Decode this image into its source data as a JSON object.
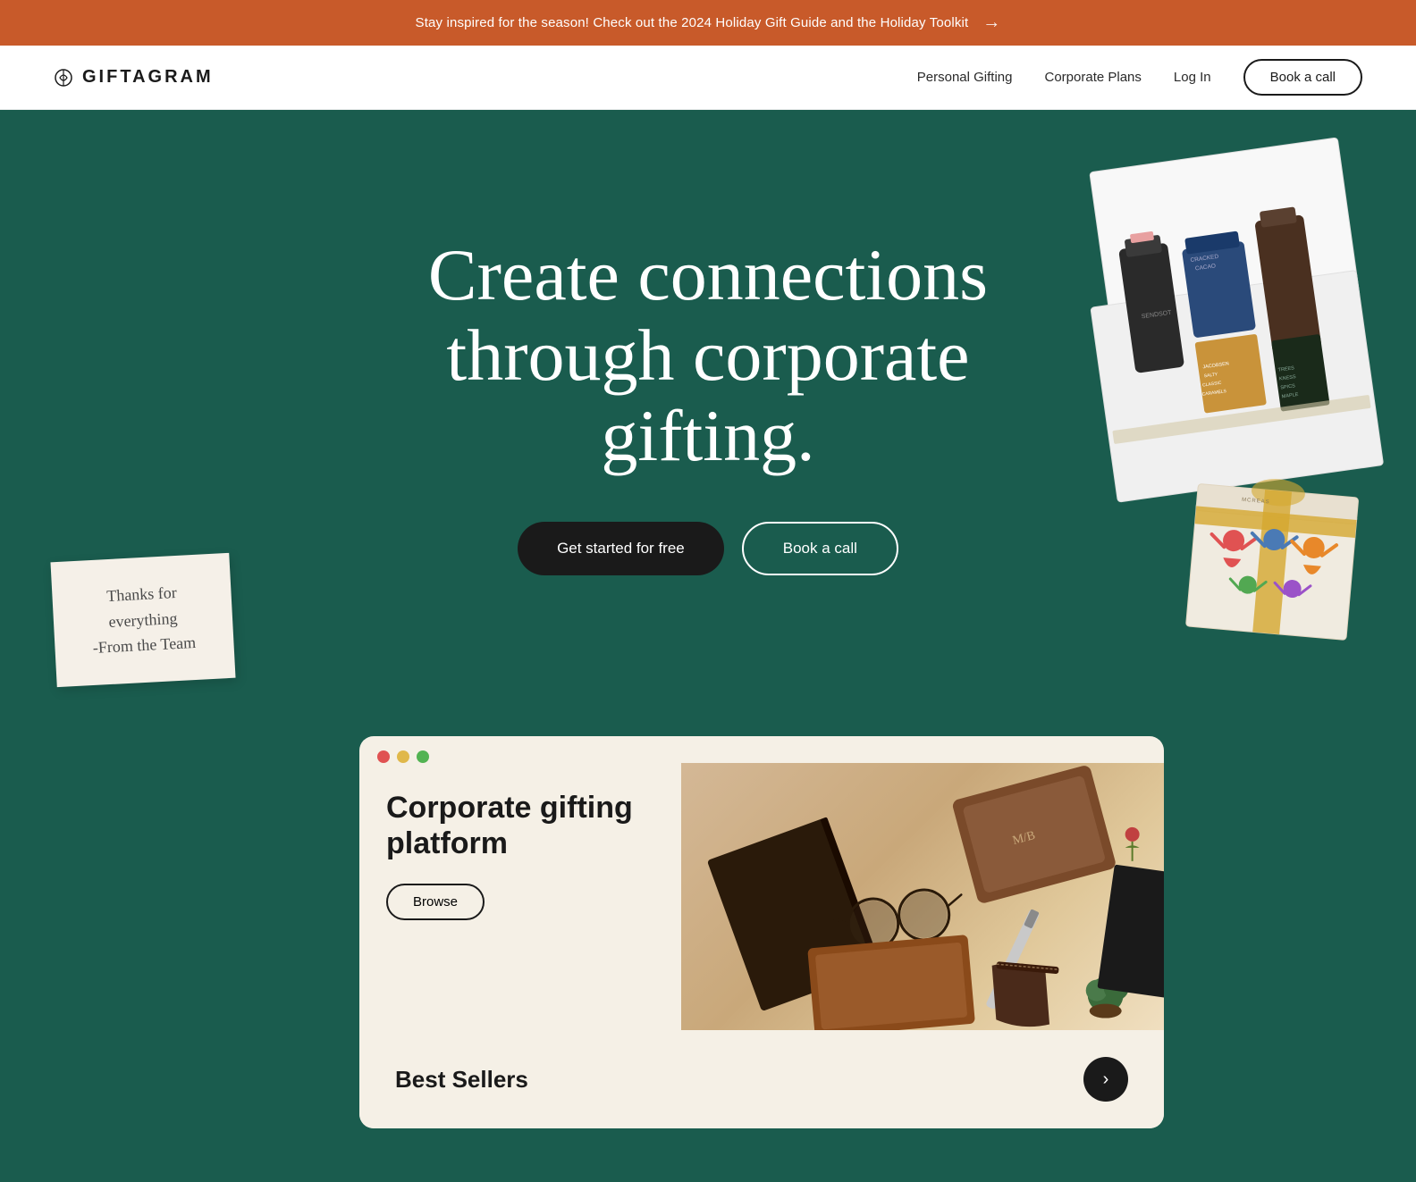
{
  "banner": {
    "text": "Stay inspired for the season! Check out the 2024 Holiday Gift Guide and the Holiday Toolkit",
    "arrow": "→"
  },
  "nav": {
    "logo_text": "GIFTAGRAM",
    "links": [
      {
        "label": "Personal Gifting",
        "id": "personal-gifting"
      },
      {
        "label": "Corporate Plans",
        "id": "corporate-plans"
      },
      {
        "label": "Log In",
        "id": "log-in"
      }
    ],
    "book_call_label": "Book a call"
  },
  "hero": {
    "title_line1": "Create connections",
    "title_line2": "through corporate gifting.",
    "btn_primary": "Get started for free",
    "btn_secondary": "Book a call"
  },
  "thank_you_note": {
    "line1": "Thanks for",
    "line2": "everything",
    "line3": "-From the Team"
  },
  "platform_card": {
    "title": "Corporate gifting platform",
    "browse_btn": "Browse",
    "dots": [
      "red",
      "yellow",
      "green"
    ]
  },
  "best_sellers": {
    "title": "Best Sellers"
  }
}
